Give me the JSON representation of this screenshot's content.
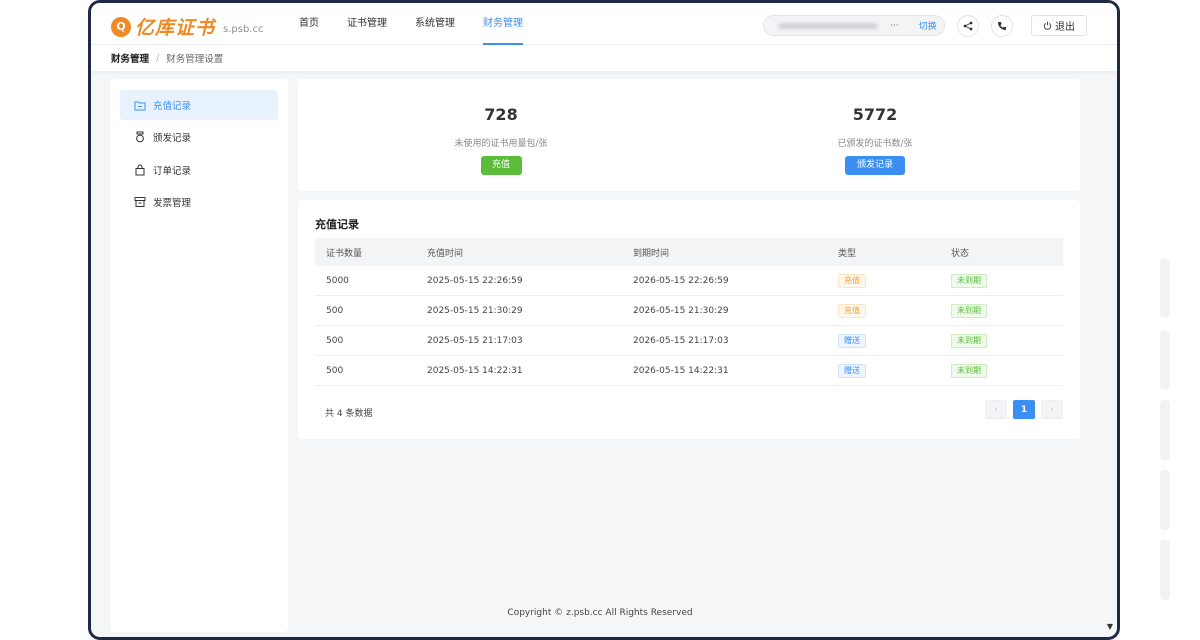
{
  "header": {
    "logo_mark": "Q",
    "logo_text": "亿库证书",
    "logo_domain": "s.psb.cc",
    "nav": [
      "首页",
      "证书管理",
      "系统管理",
      "财务管理"
    ],
    "account": {
      "dots": "···",
      "switch_label": "切换"
    },
    "logout_label": "退出",
    "icons": {
      "share": "share-icon",
      "phone": "phone-icon",
      "power": "power-icon"
    }
  },
  "breadcrumb": {
    "root": "财务管理",
    "separator": "/",
    "current": "财务管理设置"
  },
  "sidebar": {
    "items": [
      {
        "label": "充值记录",
        "icon": "folder-icon"
      },
      {
        "label": "颁发记录",
        "icon": "medal-icon"
      },
      {
        "label": "订单记录",
        "icon": "bag-icon"
      },
      {
        "label": "发票管理",
        "icon": "invoice-icon"
      }
    ]
  },
  "stats": {
    "unused": {
      "value": "728",
      "label": "未使用的证书用量包/张",
      "button": "充值"
    },
    "issued": {
      "value": "5772",
      "label": "已颁发的证书数/张",
      "button": "颁发记录"
    }
  },
  "records": {
    "title": "充值记录",
    "columns": [
      "证书数量",
      "充值时间",
      "到期时间",
      "类型",
      "状态"
    ],
    "rows": [
      {
        "qty": "5000",
        "recharge_time": "2025-05-15 22:26:59",
        "expire_time": "2026-05-15 22:26:59",
        "type": "充值",
        "status": "未到期"
      },
      {
        "qty": "500",
        "recharge_time": "2025-05-15 21:30:29",
        "expire_time": "2026-05-15 21:30:29",
        "type": "充值",
        "status": "未到期"
      },
      {
        "qty": "500",
        "recharge_time": "2025-05-15 21:17:03",
        "expire_time": "2026-05-15 21:17:03",
        "type": "赠送",
        "status": "未到期"
      },
      {
        "qty": "500",
        "recharge_time": "2025-05-15 14:22:31",
        "expire_time": "2026-05-15 14:22:31",
        "type": "赠送",
        "status": "未到期"
      }
    ],
    "total": "共 4 条数据",
    "pagination": {
      "prev": "‹",
      "current": "1",
      "next": "›"
    }
  },
  "footer": {
    "copyright": "Copyright © z.psb.cc All Rights Reserved"
  },
  "colors": {
    "accent": "#3b8ff3",
    "brand": "#f08a24",
    "success": "#5bbd3b",
    "frame": "#1f2a44"
  }
}
